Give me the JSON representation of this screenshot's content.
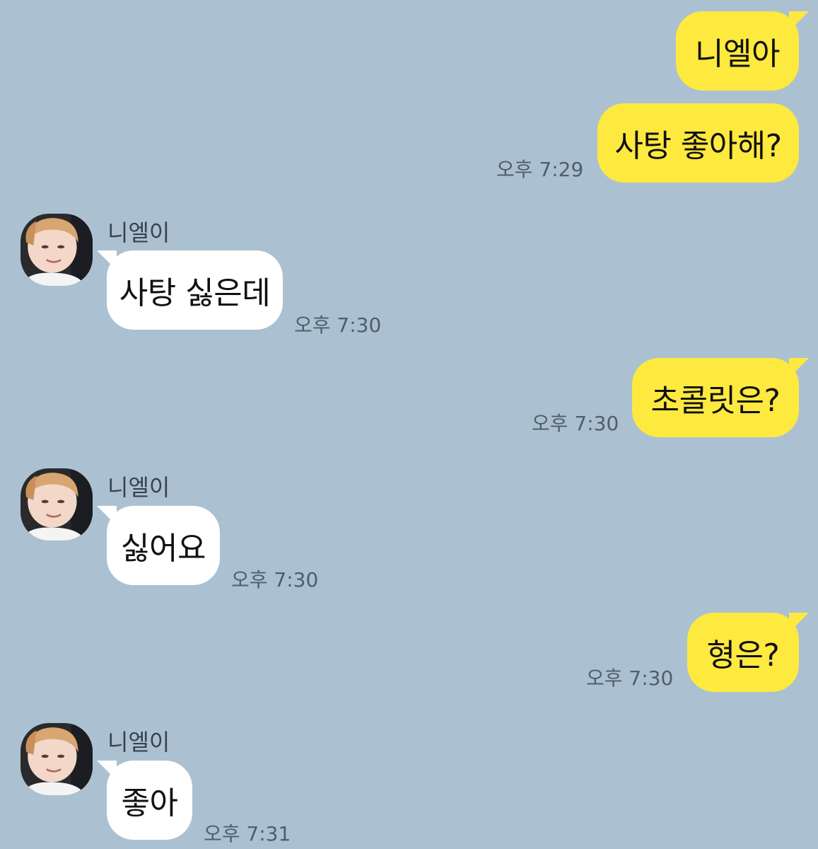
{
  "messages": [
    {
      "sender": "me",
      "text": "니엘아"
    },
    {
      "sender": "me",
      "text": "사탕 좋아해?",
      "time": "오후 7:29"
    },
    {
      "sender": "them",
      "name": "니엘이",
      "text": "사탕 싫은데",
      "time": "오후 7:30"
    },
    {
      "sender": "me",
      "text": "초콜릿은?",
      "time": "오후 7:30"
    },
    {
      "sender": "them",
      "name": "니엘이",
      "text": "싫어요",
      "time": "오후 7:30"
    },
    {
      "sender": "me",
      "text": "형은?",
      "time": "오후 7:30"
    },
    {
      "sender": "them",
      "name": "니엘이",
      "text": "좋아",
      "time": "오후 7:31"
    }
  ],
  "colors": {
    "background": "#abc1d1",
    "my_bubble": "#fee93f",
    "their_bubble": "#ffffff"
  },
  "icons": {
    "avatar": "profile-photo"
  }
}
